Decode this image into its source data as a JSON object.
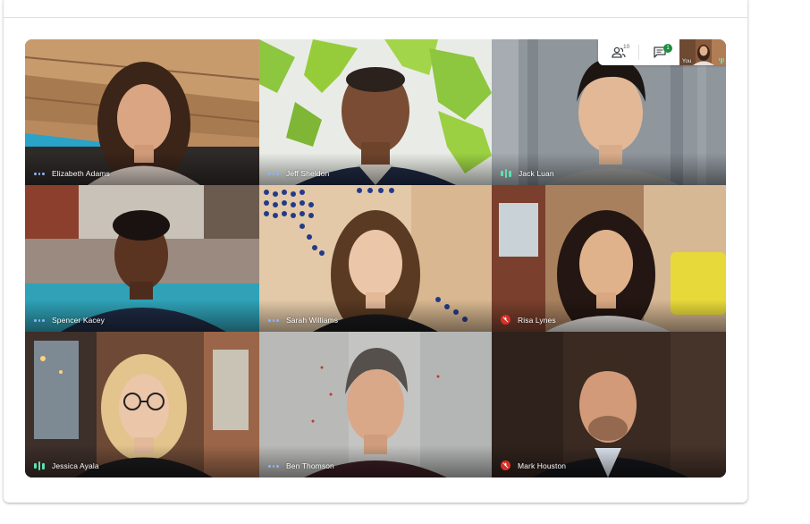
{
  "participants": [
    {
      "name": "Elizabeth Adams",
      "status": "idle"
    },
    {
      "name": "Jeff Sheldon",
      "status": "idle"
    },
    {
      "name": "Jack Luan",
      "status": "speaking"
    },
    {
      "name": "Spencer Kacey",
      "status": "idle"
    },
    {
      "name": "Sarah Williams",
      "status": "idle"
    },
    {
      "name": "Risa Lynes",
      "status": "muted"
    },
    {
      "name": "Jessica Ayala",
      "status": "speaking"
    },
    {
      "name": "Ben Thomson",
      "status": "idle"
    },
    {
      "name": "Mark Houston",
      "status": "muted"
    }
  ],
  "controls": {
    "people_count": "10",
    "chat_badge": "1",
    "self_label": "You"
  },
  "colors": {
    "idle_dots": "#8ab4f8",
    "speaking_bars": "#5ee0b0",
    "muted": "#d93025",
    "chat_badge": "#1e8e3e"
  }
}
